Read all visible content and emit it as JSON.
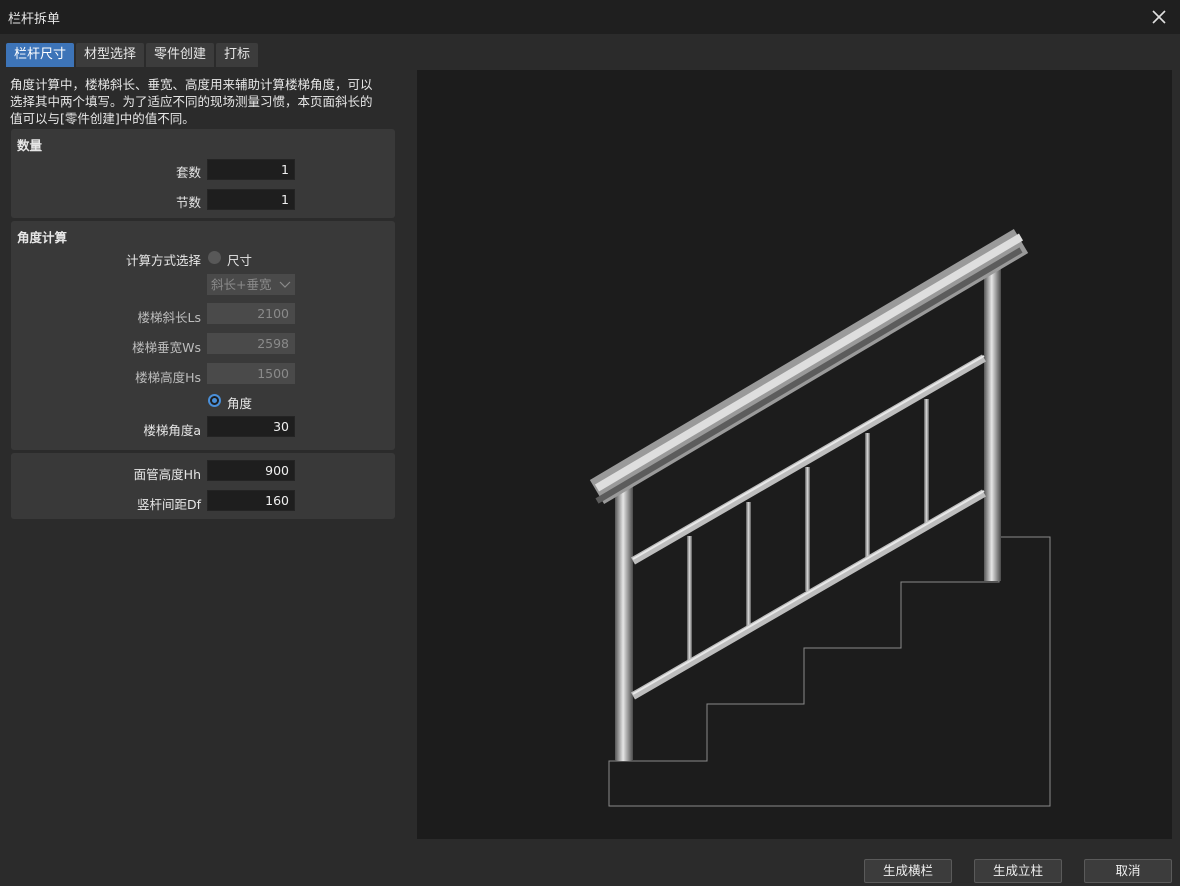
{
  "window": {
    "title": "栏杆拆单"
  },
  "tabs": [
    {
      "label": "栏杆尺寸",
      "active": true
    },
    {
      "label": "材型选择",
      "active": false
    },
    {
      "label": "零件创建",
      "active": false
    },
    {
      "label": "打标",
      "active": false
    }
  ],
  "intro": {
    "line1": "角度计算中，楼梯斜长、垂宽、高度用来辅助计算楼梯角度，可以",
    "line2": "选择其中两个填写。为了适应不同的现场测量习惯，本页面斜长的",
    "line3": "值可以与[零件创建]中的值不同。"
  },
  "quantity": {
    "title": "数量",
    "sets_label": "套数",
    "sets_value": "1",
    "sections_label": "节数",
    "sections_value": "1"
  },
  "angle_calc": {
    "title": "角度计算",
    "method_label": "计算方式选择",
    "option_size": "尺寸",
    "size_selected": false,
    "combo_value": "斜长+垂宽",
    "slope_length_label": "楼梯斜长Ls",
    "slope_length_value": "2100",
    "vertical_width_label": "楼梯垂宽Ws",
    "vertical_width_value": "2598",
    "height_label": "楼梯高度Hs",
    "height_value": "1500",
    "option_angle": "角度",
    "angle_selected": true,
    "angle_label": "楼梯角度a",
    "angle_value": "30"
  },
  "dimensions": {
    "handrail_height_label": "面管高度Hh",
    "handrail_height_value": "900",
    "baluster_spacing_label": "竖杆间距Df",
    "baluster_spacing_value": "160"
  },
  "buttons": {
    "generate_rail": "生成横栏",
    "generate_post": "生成立柱",
    "cancel": "取消"
  },
  "colors": {
    "accent": "#3d74b8",
    "radio_on": "#4a8fd8"
  },
  "icons": {
    "close": "close-icon",
    "combo": "chevron-down-icon"
  }
}
